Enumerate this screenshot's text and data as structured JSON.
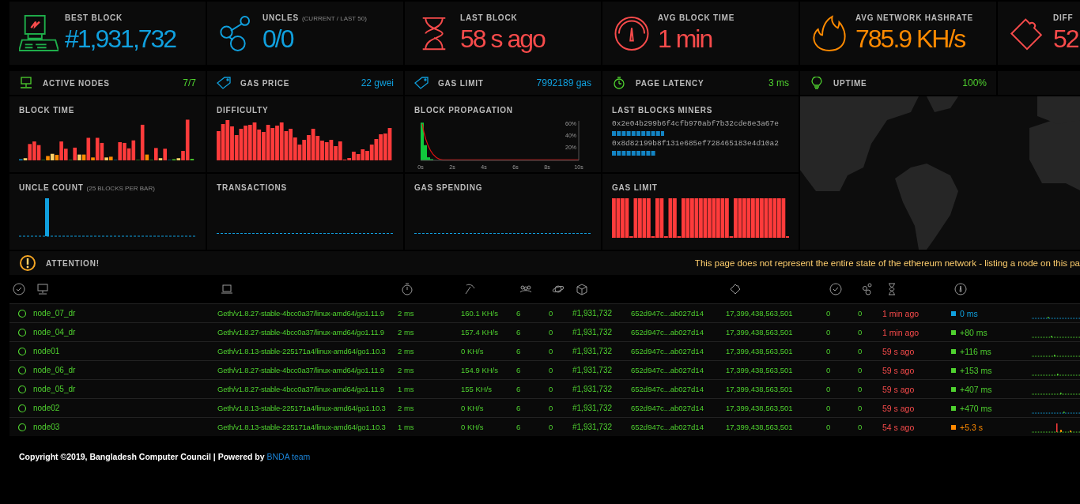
{
  "stats": [
    {
      "kind": "block",
      "title": "BEST BLOCK",
      "value": "#1,931,732",
      "color": "#10a0de"
    },
    {
      "kind": "uncles",
      "title": "UNCLES",
      "note": "(CURRENT / LAST 50)",
      "value": "0/0",
      "color": "#10a0de"
    },
    {
      "kind": "last-block",
      "title": "LAST BLOCK",
      "value": "58 s ago",
      "color": "#f74b4b"
    },
    {
      "kind": "block-time",
      "title": "AVG BLOCK TIME",
      "value": "1 min",
      "color": "#f74b4b"
    },
    {
      "kind": "hashrate",
      "title": "AVG NETWORK HASHRATE",
      "value": "785.9 KH/s",
      "color": "#ff8a00"
    },
    {
      "kind": "difficulty",
      "title": "DIFF",
      "value": "52",
      "color": "#f74b4b"
    }
  ],
  "small_stats": [
    {
      "kind": "nodes",
      "label": "ACTIVE NODES",
      "value": "7/7",
      "color": "#4fd12f"
    },
    {
      "kind": "gas-price",
      "label": "GAS PRICE",
      "value": "22 gwei",
      "color": "#10a0de"
    },
    {
      "kind": "gas-limit",
      "label": "GAS LIMIT",
      "value": "7992189 gas",
      "color": "#10a0de"
    },
    {
      "kind": "latency",
      "label": "PAGE LATENCY",
      "value": "3 ms",
      "color": "#4fd12f"
    },
    {
      "kind": "uptime",
      "label": "UPTIME",
      "value": "100%",
      "color": "#4fd12f"
    }
  ],
  "charts": [
    {
      "kind": "block-time",
      "title": "BLOCK TIME"
    },
    {
      "kind": "difficulty",
      "title": "DIFFICULTY"
    },
    {
      "kind": "propagation",
      "title": "BLOCK PROPAGATION",
      "chart_data": {
        "type": "bar",
        "x": [
          0.1,
          0.3,
          0.5,
          0.7
        ],
        "series": [
          {
            "color": "#10c83c",
            "values": [
              0.62,
              0.25,
              0.05,
              0.02
            ]
          }
        ],
        "xlim": [
          0,
          10
        ],
        "ylim": [
          0,
          0.65
        ],
        "xticks": [
          {
            "value": 0,
            "label": "0s"
          },
          {
            "value": 2,
            "label": "2s"
          },
          {
            "value": 4,
            "label": "4s"
          },
          {
            "value": 6,
            "label": "6s"
          },
          {
            "value": 8,
            "label": "8s"
          },
          {
            "value": 10,
            "label": "10s"
          }
        ],
        "yticks": [
          {
            "value": 0.2,
            "label": "20%"
          },
          {
            "value": 0.4,
            "label": "40%"
          },
          {
            "value": 0.6,
            "label": "60%"
          }
        ]
      }
    },
    {
      "kind": "miners",
      "title": "LAST BLOCKS MINERS",
      "miners": [
        {
          "address": "0x2e04b299b6f4cfb970abf7b32cde8e3a67e"
        },
        {
          "address": "0x8d82199b8f131e685ef728465183e4d10a2"
        }
      ]
    },
    {
      "kind": "uncles",
      "title": "UNCLE COUNT",
      "note": "(25 BLOCKS PER BAR)"
    },
    {
      "kind": "empty",
      "title": "TRANSACTIONS"
    },
    {
      "kind": "empty",
      "title": "GAS SPENDING"
    },
    {
      "kind": "gas-limit",
      "title": "GAS LIMIT"
    }
  ],
  "attention": {
    "label": "ATTENTION!",
    "message": "This page does not represent the entire state of the ethereum network - listing a node on this pa"
  },
  "table": {
    "rows": [
      {
        "name": "node_07_dr",
        "client": "Geth/v1.8.27-stable-4bcc0a37/linux-amd64/go1.11.9",
        "latency": "2 ms",
        "hashrate": "160.1 KH/s",
        "peers": "6",
        "pending": "0",
        "block": "#1,931,732",
        "block_hash": "652d947c...ab027d14",
        "total_difficulty": "17,399,438,563,501",
        "column_11": "0",
        "column_12": "0",
        "last_block": "1 min ago",
        "propagation": "0 ms",
        "color": "#10a0de"
      },
      {
        "name": "node_04_dr",
        "client": "Geth/v1.8.27-stable-4bcc0a37/linux-amd64/go1.11.9",
        "latency": "2 ms",
        "hashrate": "157.4 KH/s",
        "peers": "6",
        "pending": "0",
        "block": "#1,931,732",
        "block_hash": "652d947c...ab027d14",
        "total_difficulty": "17,399,438,563,501",
        "column_11": "0",
        "column_12": "0",
        "last_block": "1 min ago",
        "propagation": "+80 ms",
        "color": "#4fd12f"
      },
      {
        "name": "node01",
        "client": "Geth/v1.8.13-stable-225171a4/linux-amd64/go1.10.3",
        "latency": "2 ms",
        "hashrate": "0 KH/s",
        "peers": "6",
        "pending": "0",
        "block": "#1,931,732",
        "block_hash": "652d947c...ab027d14",
        "total_difficulty": "17,399,438,563,501",
        "column_11": "0",
        "column_12": "0",
        "last_block": "59 s ago",
        "propagation": "+116 ms",
        "color": "#4fd12f"
      },
      {
        "name": "node_06_dr",
        "client": "Geth/v1.8.27-stable-4bcc0a37/linux-amd64/go1.11.9",
        "latency": "2 ms",
        "hashrate": "154.9 KH/s",
        "peers": "6",
        "pending": "0",
        "block": "#1,931,732",
        "block_hash": "652d947c...ab027d14",
        "total_difficulty": "17,399,438,563,501",
        "column_11": "0",
        "column_12": "0",
        "last_block": "59 s ago",
        "propagation": "+153 ms",
        "color": "#4fd12f"
      },
      {
        "name": "node_05_dr",
        "client": "Geth/v1.8.27-stable-4bcc0a37/linux-amd64/go1.11.9",
        "latency": "1 ms",
        "hashrate": "155 KH/s",
        "peers": "6",
        "pending": "0",
        "block": "#1,931,732",
        "block_hash": "652d947c...ab027d14",
        "total_difficulty": "17,399,438,563,501",
        "column_11": "0",
        "column_12": "0",
        "last_block": "59 s ago",
        "propagation": "+407 ms",
        "color": "#4fd12f"
      },
      {
        "name": "node02",
        "client": "Geth/v1.8.13-stable-225171a4/linux-amd64/go1.10.3",
        "latency": "2 ms",
        "hashrate": "0 KH/s",
        "peers": "6",
        "pending": "0",
        "block": "#1,931,732",
        "block_hash": "652d947c...ab027d14",
        "total_difficulty": "17,399,438,563,501",
        "column_11": "0",
        "column_12": "0",
        "last_block": "59 s ago",
        "propagation": "+470 ms",
        "color": "#4fd12f"
      },
      {
        "name": "node03",
        "client": "Geth/v1.8.13-stable-225171a4/linux-amd64/go1.10.3",
        "latency": "1 ms",
        "hashrate": "0 KH/s",
        "peers": "6",
        "pending": "0",
        "block": "#1,931,732",
        "block_hash": "652d947c...ab027d14",
        "total_difficulty": "17,399,438,563,501",
        "column_11": "0",
        "column_12": "0",
        "last_block": "54 s ago",
        "propagation": "+5.3 s",
        "color": "#ff8a00"
      }
    ]
  },
  "footer": {
    "text": "Copyright ©2019, Bangladesh Computer Council | Powered by",
    "link": "BNDA team"
  }
}
